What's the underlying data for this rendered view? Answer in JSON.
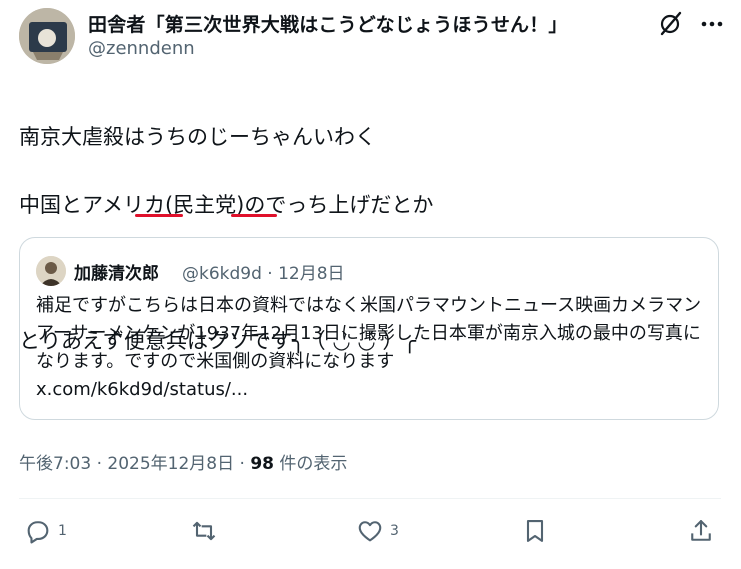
{
  "author": {
    "display_name": "田舎者「第三次世界大戦はこうどなじょうほうせん！」",
    "handle": "@zenndenn"
  },
  "tweet": {
    "line1": "南京大虐殺はうちのじーちゃんいわく",
    "line2": "中国とアメリカ(民主党)のでっち上げだとか",
    "line3": "とりあえず便意兵はクソです╮（ ◡̀ ◡́ ）╭"
  },
  "quote": {
    "display_name": "加藤清次郎",
    "handle_date": "@k6kd9d · 12月8日",
    "text": "補足ですがこちらは日本の資料ではなく米国パラマウントニュース映画カメラマンアーサーメンケンが1937年12月13日に撮影した日本軍が南京入城の最中の写真になります。ですので米国側の資料になります",
    "link": "x.com/k6kd9d/status/..."
  },
  "meta": {
    "time": "午後7:03 · 2025年12月8日 · ",
    "views": "98",
    "views_label": " 件の表示"
  },
  "actions": {
    "reply_count": "1",
    "like_count": "3"
  },
  "colors": {
    "text": "#0f1419",
    "secondary": "#536471",
    "border": "#cfd9de",
    "underline": "#e0102b"
  }
}
